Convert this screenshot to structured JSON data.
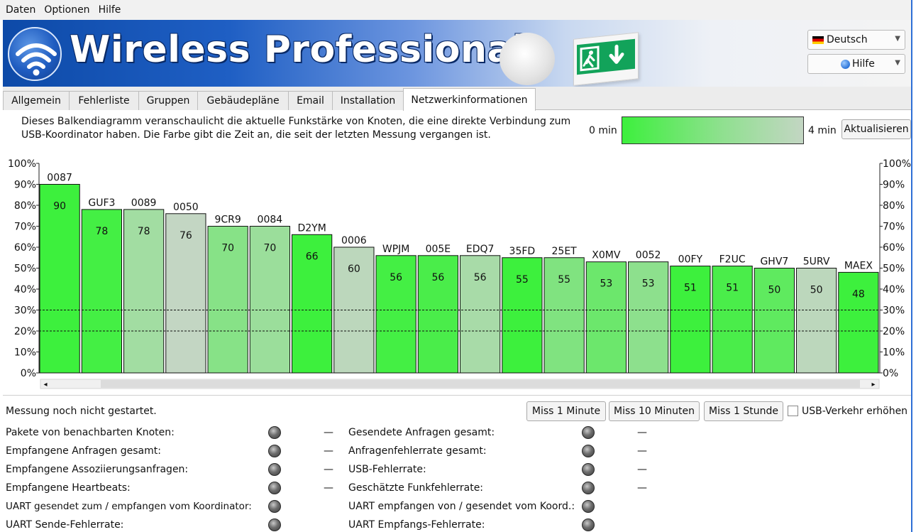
{
  "menu": [
    "Daten",
    "Optionen",
    "Hilfe"
  ],
  "header": {
    "brand": "Wireless Professional",
    "language": "Deutsch",
    "help": "Hilfe"
  },
  "tabs": [
    "Allgemein",
    "Fehlerliste",
    "Gruppen",
    "Gebäudepläne",
    "Email",
    "Installation",
    "Netzwerkinformationen"
  ],
  "active_tab": "Netzwerkinformationen",
  "description_line1": "Dieses Balkendiagramm veranschaulicht die aktuelle Funkstärke von Knoten, die eine direkte Verbindung zum",
  "description_line2": "USB-Koordinator haben. Die Farbe gibt die Zeit an, die seit der letzten Messung vergangen ist.",
  "legend_min": "0 min",
  "legend_max": "4 min",
  "refresh_button": "Aktualisieren",
  "colors": {
    "fresh": "#3df03d",
    "old": "#c3d6c3",
    "accent": "#2e6fd6"
  },
  "chart_data": {
    "type": "bar",
    "categories": [
      "0087",
      "GUF3",
      "0089",
      "0050",
      "9CR9",
      "0084",
      "D2YM",
      "0006",
      "WPJM",
      "005E",
      "EDQ7",
      "35FD",
      "25ET",
      "X0MV",
      "0052",
      "00FY",
      "F2UC",
      "GHV7",
      "5URV",
      "MAEX"
    ],
    "values": [
      90,
      78,
      78,
      76,
      70,
      70,
      66,
      60,
      56,
      56,
      56,
      55,
      55,
      53,
      53,
      51,
      51,
      50,
      50,
      48
    ],
    "age_fraction": [
      0.0,
      0.05,
      0.75,
      1.0,
      0.55,
      0.7,
      0.0,
      0.95,
      0.05,
      0.1,
      0.8,
      0.0,
      0.5,
      0.35,
      0.6,
      0.0,
      0.1,
      0.25,
      0.95,
      0.0
    ],
    "yticks": [
      "0%",
      "10%",
      "20%",
      "30%",
      "40%",
      "50%",
      "60%",
      "70%",
      "80%",
      "90%",
      "100%"
    ],
    "ylim": [
      0,
      100
    ],
    "reference_lines": [
      20,
      30
    ],
    "grid": false
  },
  "status_text": "Messung noch nicht gestartet.",
  "measure_buttons": [
    "Miss 1 Minute",
    "Miss 10 Minuten",
    "Miss 1 Stunde"
  ],
  "usb_checkbox_label": "USB-Verkehr erhöhen",
  "stats_left": [
    {
      "label": "Pakete von benachbarten Knoten:",
      "value": "—"
    },
    {
      "label": "Empfangene Anfragen gesamt:",
      "value": "—"
    },
    {
      "label": "Empfangene Assoziierungsanfragen:",
      "value": "—"
    },
    {
      "label": "Empfangene Heartbeats:",
      "value": "—"
    },
    {
      "label": "UART gesendet zum / empfangen vom Koordinator:",
      "value": ""
    },
    {
      "label": "UART Sende-Fehlerrate:",
      "value": ""
    }
  ],
  "stats_right": [
    {
      "label": "Gesendete Anfragen gesamt:",
      "value": "—"
    },
    {
      "label": "Anfragenfehlerrate gesamt:",
      "value": "—"
    },
    {
      "label": "USB-Fehlerrate:",
      "value": "—"
    },
    {
      "label": "Geschätzte Funkfehlerrate:",
      "value": "—"
    },
    {
      "label": "UART empfangen von / gesendet vom Koord.:",
      "value": ""
    },
    {
      "label": "UART Empfangs-Fehlerrate:",
      "value": ""
    }
  ]
}
